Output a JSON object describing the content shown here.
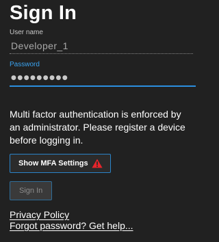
{
  "title": "Sign In",
  "username": {
    "label": "User name",
    "value": "Developer_1"
  },
  "password": {
    "label": "Password",
    "masked_value": "●●●●●●●●●"
  },
  "mfa": {
    "message": "Multi factor authentication is enforced by an administrator. Please register a device before logging in.",
    "button_label": "Show MFA Settings",
    "button_icon": "warning-icon",
    "warning_color": "#e8242b"
  },
  "sign_in": {
    "button_label": "Sign In",
    "state": "disabled"
  },
  "links": {
    "privacy_policy": "Privacy Policy",
    "forgot_password": "Forgot password? Get help..."
  },
  "colors": {
    "background": "#212121",
    "accent": "#2b8fe0",
    "text": "#ffffff"
  }
}
